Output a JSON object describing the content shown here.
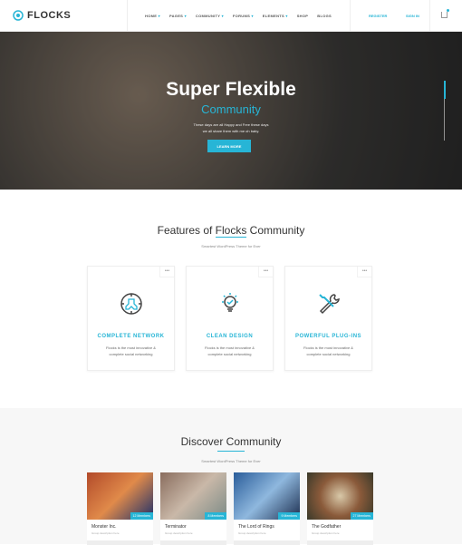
{
  "header": {
    "logo": "FLOCKS",
    "nav": [
      {
        "label": "HOME",
        "caret": true
      },
      {
        "label": "PAGES",
        "caret": true
      },
      {
        "label": "COMMUNITY",
        "caret": true
      },
      {
        "label": "FORUMS",
        "caret": true
      },
      {
        "label": "ELEMENTS",
        "caret": true
      },
      {
        "label": "SHOP",
        "caret": false
      },
      {
        "label": "BLOGS",
        "caret": false
      }
    ],
    "register": "REGISTER",
    "signin": "SIGN IN"
  },
  "hero": {
    "title": "Super Flexible",
    "subtitle": "Community",
    "text_line1": "These days are all Happy and Free these days",
    "text_line2": "we all share them with me oh baby.",
    "button": "LEARN MORE"
  },
  "features": {
    "title_pre": "Features of ",
    "title_accent": "Flocks",
    "title_post": " Community",
    "subtitle": "Smartest WordPress Theme for Ever",
    "cards": [
      {
        "title": "COMPLETE NETWORK",
        "text1": "Flocks is the most innovative &",
        "text2": "complete social networking",
        "icon": "network-icon"
      },
      {
        "title": "CLEAN DESIGN",
        "text1": "Flocks is the most innovative &",
        "text2": "complete social networking",
        "icon": "lightbulb-icon"
      },
      {
        "title": "POWERFUL PLUG-INS",
        "text1": "Flocks is the most innovative &",
        "text2": "complete social networking",
        "icon": "wrench-screwdriver-icon"
      }
    ],
    "menu_dots": "•••"
  },
  "discover": {
    "title": "Discover Community",
    "subtitle": "Smartest WordPress Theme for Ever",
    "groups": [
      {
        "name": "Monster Inc.",
        "desc": "Group description here",
        "members": "12 Members"
      },
      {
        "name": "Terminator",
        "desc": "Group description here",
        "members": "8 Members"
      },
      {
        "name": "The Lord of Rings",
        "desc": "Group description here",
        "members": "9 Members"
      },
      {
        "name": "The Godfather",
        "desc": "Group description here",
        "members": "27 Members"
      }
    ]
  },
  "colors": {
    "accent": "#27b5d6"
  }
}
